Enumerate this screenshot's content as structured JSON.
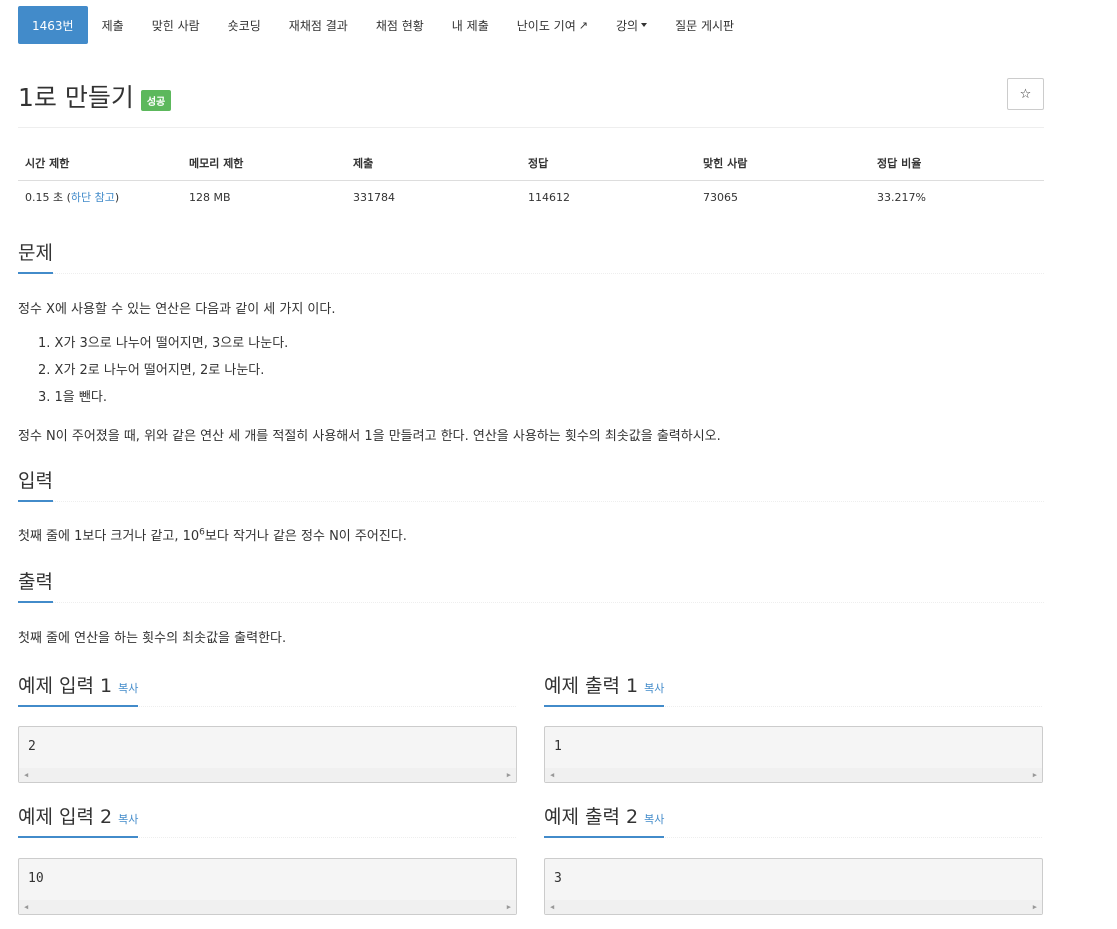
{
  "nav": {
    "items": [
      {
        "label": "1463번",
        "active": true
      },
      {
        "label": "제출"
      },
      {
        "label": "맞힌 사람"
      },
      {
        "label": "숏코딩"
      },
      {
        "label": "재채점 결과"
      },
      {
        "label": "채점 현황"
      },
      {
        "label": "내 제출"
      },
      {
        "label": "난이도 기여",
        "icon": "external-link-icon"
      },
      {
        "label": "강의",
        "icon": "caret-down-icon"
      },
      {
        "label": "질문 게시판"
      }
    ]
  },
  "problem": {
    "title": "1로 만들기",
    "badge": "성공",
    "star_icon": "☆"
  },
  "info": {
    "headers": [
      "시간 제한",
      "메모리 제한",
      "제출",
      "정답",
      "맞힌 사람",
      "정답 비율"
    ],
    "time_value": "0.15 초 (",
    "time_link": "하단 참고",
    "time_close": ")",
    "memory": "128 MB",
    "submissions": "331784",
    "accepted": "114612",
    "solvers": "73065",
    "ratio": "33.217%"
  },
  "statement": {
    "heading": "문제",
    "intro": "정수 X에 사용할 수 있는 연산은 다음과 같이 세 가지 이다.",
    "ops": [
      "1. X가 3으로 나누어 떨어지면, 3으로 나눈다.",
      "2. X가 2로 나누어 떨어지면, 2로 나눈다.",
      "3. 1을 뺀다."
    ],
    "goal": "정수 N이 주어졌을 때, 위와 같은 연산 세 개를 적절히 사용해서 1을 만들려고 한다. 연산을 사용하는 횟수의 최솟값을 출력하시오."
  },
  "input": {
    "heading": "입력",
    "text_before": "첫째 줄에 1보다 크거나 같고, 10",
    "sup": "6",
    "text_after": "보다 작거나 같은 정수 N이 주어진다."
  },
  "output": {
    "heading": "출력",
    "text": "첫째 줄에 연산을 하는 횟수의 최솟값을 출력한다."
  },
  "samples": {
    "copy_label": "복사",
    "input1_title": "예제 입력 1",
    "output1_title": "예제 출력 1",
    "input2_title": "예제 입력 2",
    "output2_title": "예제 출력 2",
    "input1": "2",
    "output1": "1",
    "input2": "10",
    "output2": "3"
  }
}
